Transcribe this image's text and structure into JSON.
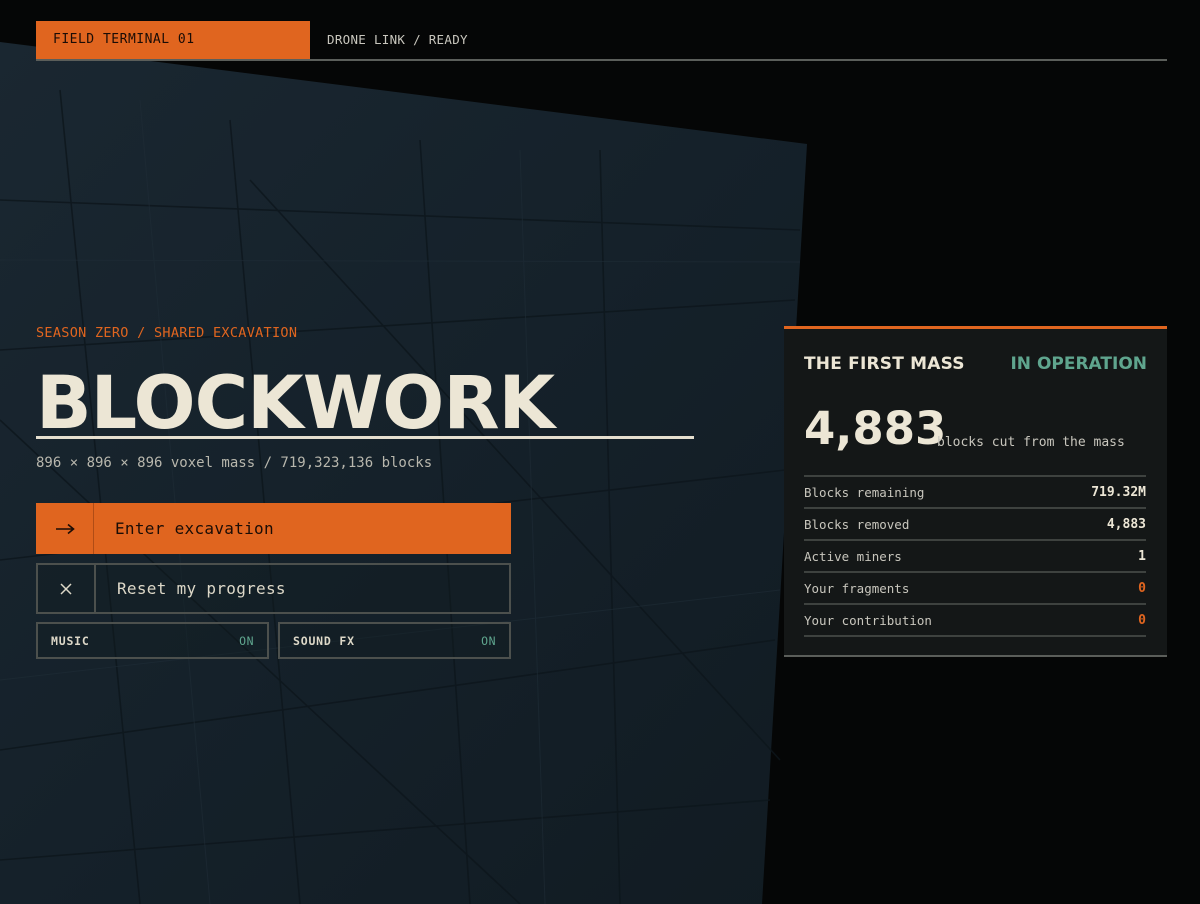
{
  "topbar": {
    "terminal_label": "FIELD TERMINAL 01",
    "link_status": "DRONE LINK / READY"
  },
  "hero": {
    "kicker": "SEASON ZERO / SHARED EXCAVATION",
    "title": "BLOCKWORK",
    "subtitle": "896 × 896 × 896 voxel mass / 719,323,136 blocks"
  },
  "actions": {
    "enter": {
      "icon": "arrow-right-icon",
      "glyph": "⟶",
      "label": "Enter excavation"
    },
    "reset": {
      "icon": "close-icon",
      "glyph": "✕",
      "label": "Reset my progress"
    }
  },
  "toggles": [
    {
      "label": "MUSIC",
      "state": "ON"
    },
    {
      "label": "SOUND FX",
      "state": "ON"
    }
  ],
  "panel": {
    "name": "THE FIRST MASS",
    "status": "IN OPERATION",
    "count": "4,883",
    "count_caption": "blocks cut from the mass",
    "stats": [
      {
        "label": "Blocks remaining",
        "value": "719.32M"
      },
      {
        "label": "Blocks removed",
        "value": "4,883"
      },
      {
        "label": "Active miners",
        "value": "1"
      },
      {
        "label": "Your fragments",
        "value": "0"
      },
      {
        "label": "Your contribution",
        "value": "0"
      }
    ]
  },
  "colors": {
    "accent": "#e0651f",
    "status_green": "#5fa58e",
    "slab": "#16222b",
    "background": "#050606",
    "text": "#ece6d5"
  }
}
